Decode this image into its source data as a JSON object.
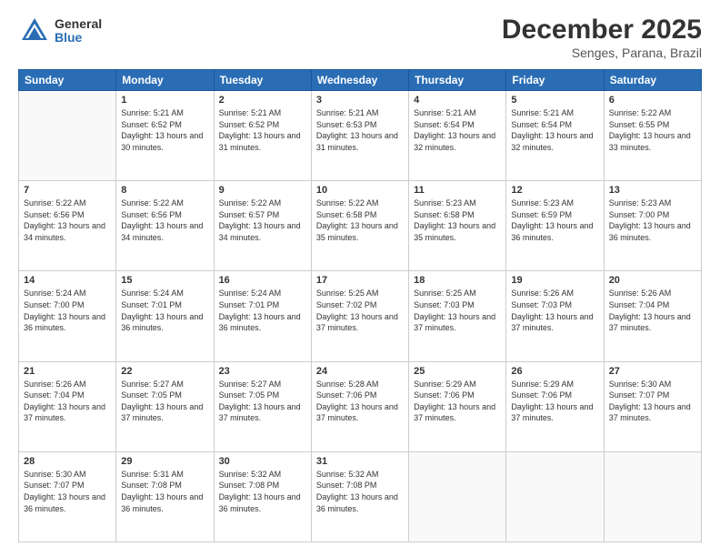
{
  "header": {
    "logo_general": "General",
    "logo_blue": "Blue",
    "month_title": "December 2025",
    "location": "Senges, Parana, Brazil"
  },
  "days_of_week": [
    "Sunday",
    "Monday",
    "Tuesday",
    "Wednesday",
    "Thursday",
    "Friday",
    "Saturday"
  ],
  "weeks": [
    [
      {
        "day": "",
        "info": ""
      },
      {
        "day": "1",
        "info": "Sunrise: 5:21 AM\nSunset: 6:52 PM\nDaylight: 13 hours\nand 30 minutes."
      },
      {
        "day": "2",
        "info": "Sunrise: 5:21 AM\nSunset: 6:52 PM\nDaylight: 13 hours\nand 31 minutes."
      },
      {
        "day": "3",
        "info": "Sunrise: 5:21 AM\nSunset: 6:53 PM\nDaylight: 13 hours\nand 31 minutes."
      },
      {
        "day": "4",
        "info": "Sunrise: 5:21 AM\nSunset: 6:54 PM\nDaylight: 13 hours\nand 32 minutes."
      },
      {
        "day": "5",
        "info": "Sunrise: 5:21 AM\nSunset: 6:54 PM\nDaylight: 13 hours\nand 32 minutes."
      },
      {
        "day": "6",
        "info": "Sunrise: 5:22 AM\nSunset: 6:55 PM\nDaylight: 13 hours\nand 33 minutes."
      }
    ],
    [
      {
        "day": "7",
        "info": "Sunrise: 5:22 AM\nSunset: 6:56 PM\nDaylight: 13 hours\nand 34 minutes."
      },
      {
        "day": "8",
        "info": "Sunrise: 5:22 AM\nSunset: 6:56 PM\nDaylight: 13 hours\nand 34 minutes."
      },
      {
        "day": "9",
        "info": "Sunrise: 5:22 AM\nSunset: 6:57 PM\nDaylight: 13 hours\nand 34 minutes."
      },
      {
        "day": "10",
        "info": "Sunrise: 5:22 AM\nSunset: 6:58 PM\nDaylight: 13 hours\nand 35 minutes."
      },
      {
        "day": "11",
        "info": "Sunrise: 5:23 AM\nSunset: 6:58 PM\nDaylight: 13 hours\nand 35 minutes."
      },
      {
        "day": "12",
        "info": "Sunrise: 5:23 AM\nSunset: 6:59 PM\nDaylight: 13 hours\nand 36 minutes."
      },
      {
        "day": "13",
        "info": "Sunrise: 5:23 AM\nSunset: 7:00 PM\nDaylight: 13 hours\nand 36 minutes."
      }
    ],
    [
      {
        "day": "14",
        "info": "Sunrise: 5:24 AM\nSunset: 7:00 PM\nDaylight: 13 hours\nand 36 minutes."
      },
      {
        "day": "15",
        "info": "Sunrise: 5:24 AM\nSunset: 7:01 PM\nDaylight: 13 hours\nand 36 minutes."
      },
      {
        "day": "16",
        "info": "Sunrise: 5:24 AM\nSunset: 7:01 PM\nDaylight: 13 hours\nand 36 minutes."
      },
      {
        "day": "17",
        "info": "Sunrise: 5:25 AM\nSunset: 7:02 PM\nDaylight: 13 hours\nand 37 minutes."
      },
      {
        "day": "18",
        "info": "Sunrise: 5:25 AM\nSunset: 7:03 PM\nDaylight: 13 hours\nand 37 minutes."
      },
      {
        "day": "19",
        "info": "Sunrise: 5:26 AM\nSunset: 7:03 PM\nDaylight: 13 hours\nand 37 minutes."
      },
      {
        "day": "20",
        "info": "Sunrise: 5:26 AM\nSunset: 7:04 PM\nDaylight: 13 hours\nand 37 minutes."
      }
    ],
    [
      {
        "day": "21",
        "info": "Sunrise: 5:26 AM\nSunset: 7:04 PM\nDaylight: 13 hours\nand 37 minutes."
      },
      {
        "day": "22",
        "info": "Sunrise: 5:27 AM\nSunset: 7:05 PM\nDaylight: 13 hours\nand 37 minutes."
      },
      {
        "day": "23",
        "info": "Sunrise: 5:27 AM\nSunset: 7:05 PM\nDaylight: 13 hours\nand 37 minutes."
      },
      {
        "day": "24",
        "info": "Sunrise: 5:28 AM\nSunset: 7:06 PM\nDaylight: 13 hours\nand 37 minutes."
      },
      {
        "day": "25",
        "info": "Sunrise: 5:29 AM\nSunset: 7:06 PM\nDaylight: 13 hours\nand 37 minutes."
      },
      {
        "day": "26",
        "info": "Sunrise: 5:29 AM\nSunset: 7:06 PM\nDaylight: 13 hours\nand 37 minutes."
      },
      {
        "day": "27",
        "info": "Sunrise: 5:30 AM\nSunset: 7:07 PM\nDaylight: 13 hours\nand 37 minutes."
      }
    ],
    [
      {
        "day": "28",
        "info": "Sunrise: 5:30 AM\nSunset: 7:07 PM\nDaylight: 13 hours\nand 36 minutes."
      },
      {
        "day": "29",
        "info": "Sunrise: 5:31 AM\nSunset: 7:08 PM\nDaylight: 13 hours\nand 36 minutes."
      },
      {
        "day": "30",
        "info": "Sunrise: 5:32 AM\nSunset: 7:08 PM\nDaylight: 13 hours\nand 36 minutes."
      },
      {
        "day": "31",
        "info": "Sunrise: 5:32 AM\nSunset: 7:08 PM\nDaylight: 13 hours\nand 36 minutes."
      },
      {
        "day": "",
        "info": ""
      },
      {
        "day": "",
        "info": ""
      },
      {
        "day": "",
        "info": ""
      }
    ]
  ]
}
